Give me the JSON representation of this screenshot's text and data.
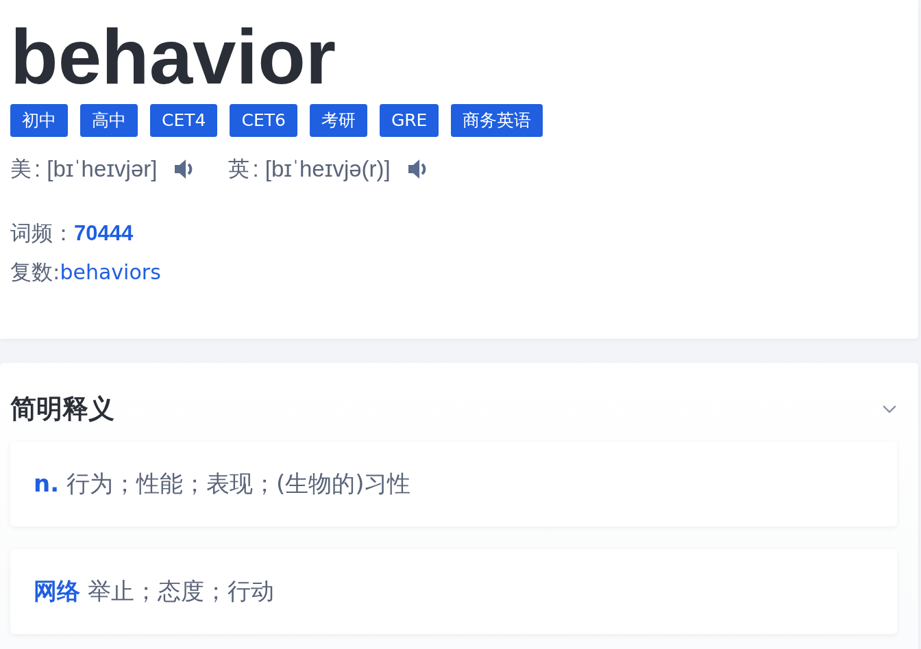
{
  "word": "behavior",
  "tags": [
    "初中",
    "高中",
    "CET4",
    "CET6",
    "考研",
    "GRE",
    "商务英语"
  ],
  "pronunciations": [
    {
      "label": "美",
      "ipa": ": [bɪˈheɪvjər]"
    },
    {
      "label": "英",
      "ipa": ": [bɪˈheɪvjə(r)]"
    }
  ],
  "frequency": {
    "label": "词频：",
    "value": "70444"
  },
  "plural": {
    "label": "复数:",
    "value": "behaviors"
  },
  "section": {
    "title": "简明释义",
    "expanded": true
  },
  "definitions": [
    {
      "pos": "n.",
      "text": "行为；性能；表现；(生物的)习性"
    },
    {
      "pos": "网络",
      "text": "举止；态度；行动"
    }
  ]
}
